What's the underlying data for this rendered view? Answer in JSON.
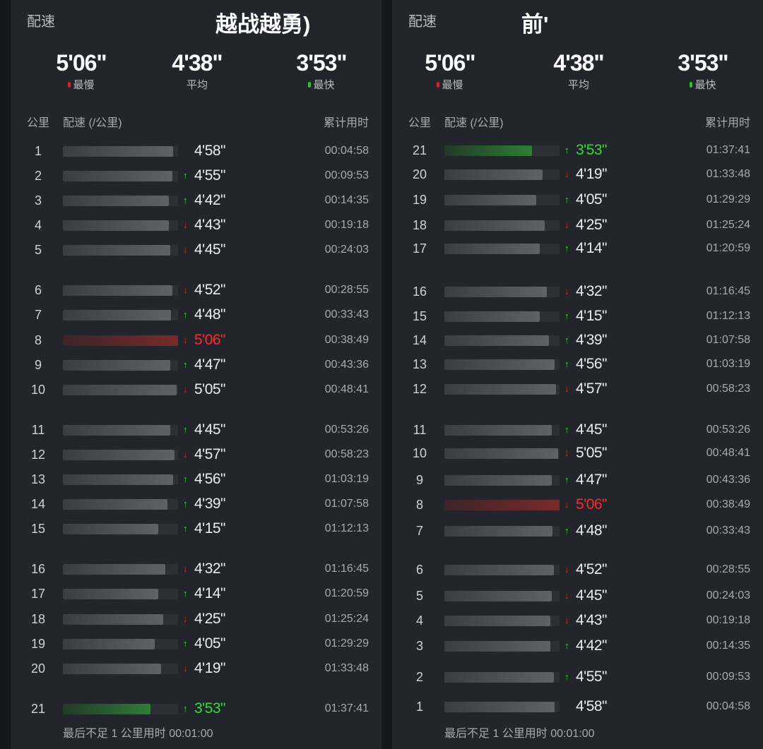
{
  "colors": {
    "slow": "#e02020",
    "fast": "#22cc22",
    "panel": "#22252b"
  },
  "left": {
    "title": "配速",
    "overlay": "越战越勇)",
    "stats": [
      {
        "value": "5'06\"",
        "label": "最慢",
        "dot": "red"
      },
      {
        "value": "4'38\"",
        "label": "平均",
        "dot": ""
      },
      {
        "value": "3'53\"",
        "label": "最快",
        "dot": "green"
      }
    ],
    "headers": {
      "km": "公里",
      "pace": "配速 (/公里)",
      "time": "累计用时"
    },
    "footer": "最后不足 1 公里用时 00:01:00",
    "rows": [
      {
        "km": "1",
        "pace": "4'58\"",
        "arrow": "",
        "cum": "00:04:58",
        "bar_pct": 96,
        "type": ""
      },
      {
        "km": "2",
        "pace": "4'55\"",
        "arrow": "up",
        "cum": "00:09:53",
        "bar_pct": 95,
        "type": ""
      },
      {
        "km": "3",
        "pace": "4'42\"",
        "arrow": "up",
        "cum": "00:14:35",
        "bar_pct": 92,
        "type": ""
      },
      {
        "km": "4",
        "pace": "4'43\"",
        "arrow": "down",
        "cum": "00:19:18",
        "bar_pct": 92,
        "type": ""
      },
      {
        "km": "5",
        "pace": "4'45\"",
        "arrow": "down",
        "cum": "00:24:03",
        "bar_pct": 93,
        "type": ""
      },
      {
        "km": "6",
        "pace": "4'52\"",
        "arrow": "down",
        "cum": "00:28:55",
        "bar_pct": 95,
        "type": ""
      },
      {
        "km": "7",
        "pace": "4'48\"",
        "arrow": "up",
        "cum": "00:33:43",
        "bar_pct": 94,
        "type": ""
      },
      {
        "km": "8",
        "pace": "5'06\"",
        "arrow": "down",
        "cum": "00:38:49",
        "bar_pct": 100,
        "type": "slowest"
      },
      {
        "km": "9",
        "pace": "4'47\"",
        "arrow": "up",
        "cum": "00:43:36",
        "bar_pct": 93,
        "type": ""
      },
      {
        "km": "10",
        "pace": "5'05\"",
        "arrow": "down",
        "cum": "00:48:41",
        "bar_pct": 99,
        "type": ""
      },
      {
        "km": "11",
        "pace": "4'45\"",
        "arrow": "up",
        "cum": "00:53:26",
        "bar_pct": 93,
        "type": ""
      },
      {
        "km": "12",
        "pace": "4'57\"",
        "arrow": "down",
        "cum": "00:58:23",
        "bar_pct": 97,
        "type": ""
      },
      {
        "km": "13",
        "pace": "4'56\"",
        "arrow": "up",
        "cum": "01:03:19",
        "bar_pct": 96,
        "type": ""
      },
      {
        "km": "14",
        "pace": "4'39\"",
        "arrow": "up",
        "cum": "01:07:58",
        "bar_pct": 91,
        "type": ""
      },
      {
        "km": "15",
        "pace": "4'15\"",
        "arrow": "up",
        "cum": "01:12:13",
        "bar_pct": 83,
        "type": ""
      },
      {
        "km": "16",
        "pace": "4'32\"",
        "arrow": "down",
        "cum": "01:16:45",
        "bar_pct": 89,
        "type": ""
      },
      {
        "km": "17",
        "pace": "4'14\"",
        "arrow": "up",
        "cum": "01:20:59",
        "bar_pct": 83,
        "type": ""
      },
      {
        "km": "18",
        "pace": "4'25\"",
        "arrow": "down",
        "cum": "01:25:24",
        "bar_pct": 87,
        "type": ""
      },
      {
        "km": "19",
        "pace": "4'05\"",
        "arrow": "up",
        "cum": "01:29:29",
        "bar_pct": 80,
        "type": ""
      },
      {
        "km": "20",
        "pace": "4'19\"",
        "arrow": "down",
        "cum": "01:33:48",
        "bar_pct": 85,
        "type": ""
      },
      {
        "km": "21",
        "pace": "3'53\"",
        "arrow": "up",
        "cum": "01:37:41",
        "bar_pct": 76,
        "type": "fastest"
      }
    ]
  },
  "right": {
    "title": "配速",
    "overlay": "前'",
    "stats": [
      {
        "value": "5'06\"",
        "label": "最慢",
        "dot": "red"
      },
      {
        "value": "4'38\"",
        "label": "平均",
        "dot": ""
      },
      {
        "value": "3'53\"",
        "label": "最快",
        "dot": "green"
      }
    ],
    "headers": {
      "km": "公里",
      "pace": "配速 (/公里)",
      "time": "累计用时"
    },
    "footer": "最后不足 1 公里用时 00:01:00",
    "rows": [
      {
        "km": "21",
        "pace": "3'53\"",
        "arrow": "up",
        "cum": "01:37:41",
        "bar_pct": 76,
        "type": "fastest"
      },
      {
        "km": "20",
        "pace": "4'19\"",
        "arrow": "down",
        "cum": "01:33:48",
        "bar_pct": 85,
        "type": ""
      },
      {
        "km": "19",
        "pace": "4'05\"",
        "arrow": "up",
        "cum": "01:29:29",
        "bar_pct": 80,
        "type": ""
      },
      {
        "km": "18",
        "pace": "4'25\"",
        "arrow": "down",
        "cum": "01:25:24",
        "bar_pct": 87,
        "type": ""
      },
      {
        "km": "17",
        "pace": "4'14\"",
        "arrow": "up",
        "cum": "01:20:59",
        "bar_pct": 83,
        "type": ""
      },
      {
        "km": "16",
        "pace": "4'32\"",
        "arrow": "down",
        "cum": "01:16:45",
        "bar_pct": 89,
        "type": ""
      },
      {
        "km": "15",
        "pace": "4'15\"",
        "arrow": "up",
        "cum": "01:12:13",
        "bar_pct": 83,
        "type": ""
      },
      {
        "km": "14",
        "pace": "4'39\"",
        "arrow": "up",
        "cum": "01:07:58",
        "bar_pct": 91,
        "type": ""
      },
      {
        "km": "13",
        "pace": "4'56\"",
        "arrow": "up",
        "cum": "01:03:19",
        "bar_pct": 96,
        "type": ""
      },
      {
        "km": "12",
        "pace": "4'57\"",
        "arrow": "down",
        "cum": "00:58:23",
        "bar_pct": 97,
        "type": ""
      },
      {
        "km": "11",
        "pace": "4'45\"",
        "arrow": "up",
        "cum": "00:53:26",
        "bar_pct": 93,
        "type": ""
      },
      {
        "km": "10",
        "pace": "5'05\"",
        "arrow": "down",
        "cum": "00:48:41",
        "bar_pct": 99,
        "type": ""
      },
      {
        "km": "9",
        "pace": "4'47\"",
        "arrow": "up",
        "cum": "00:43:36",
        "bar_pct": 93,
        "type": ""
      },
      {
        "km": "8",
        "pace": "5'06\"",
        "arrow": "down",
        "cum": "00:38:49",
        "bar_pct": 100,
        "type": "slowest"
      },
      {
        "km": "7",
        "pace": "4'48\"",
        "arrow": "up",
        "cum": "00:33:43",
        "bar_pct": 94,
        "type": ""
      },
      {
        "km": "6",
        "pace": "4'52\"",
        "arrow": "down",
        "cum": "00:28:55",
        "bar_pct": 95,
        "type": ""
      },
      {
        "km": "5",
        "pace": "4'45\"",
        "arrow": "down",
        "cum": "00:24:03",
        "bar_pct": 93,
        "type": ""
      },
      {
        "km": "4",
        "pace": "4'43\"",
        "arrow": "down",
        "cum": "00:19:18",
        "bar_pct": 92,
        "type": ""
      },
      {
        "km": "3",
        "pace": "4'42\"",
        "arrow": "up",
        "cum": "00:14:35",
        "bar_pct": 92,
        "type": ""
      },
      {
        "km": "2",
        "pace": "4'55\"",
        "arrow": "up",
        "cum": "00:09:53",
        "bar_pct": 95,
        "type": ""
      },
      {
        "km": "1",
        "pace": "4'58\"",
        "arrow": "",
        "cum": "00:04:58",
        "bar_pct": 96,
        "type": ""
      }
    ]
  }
}
